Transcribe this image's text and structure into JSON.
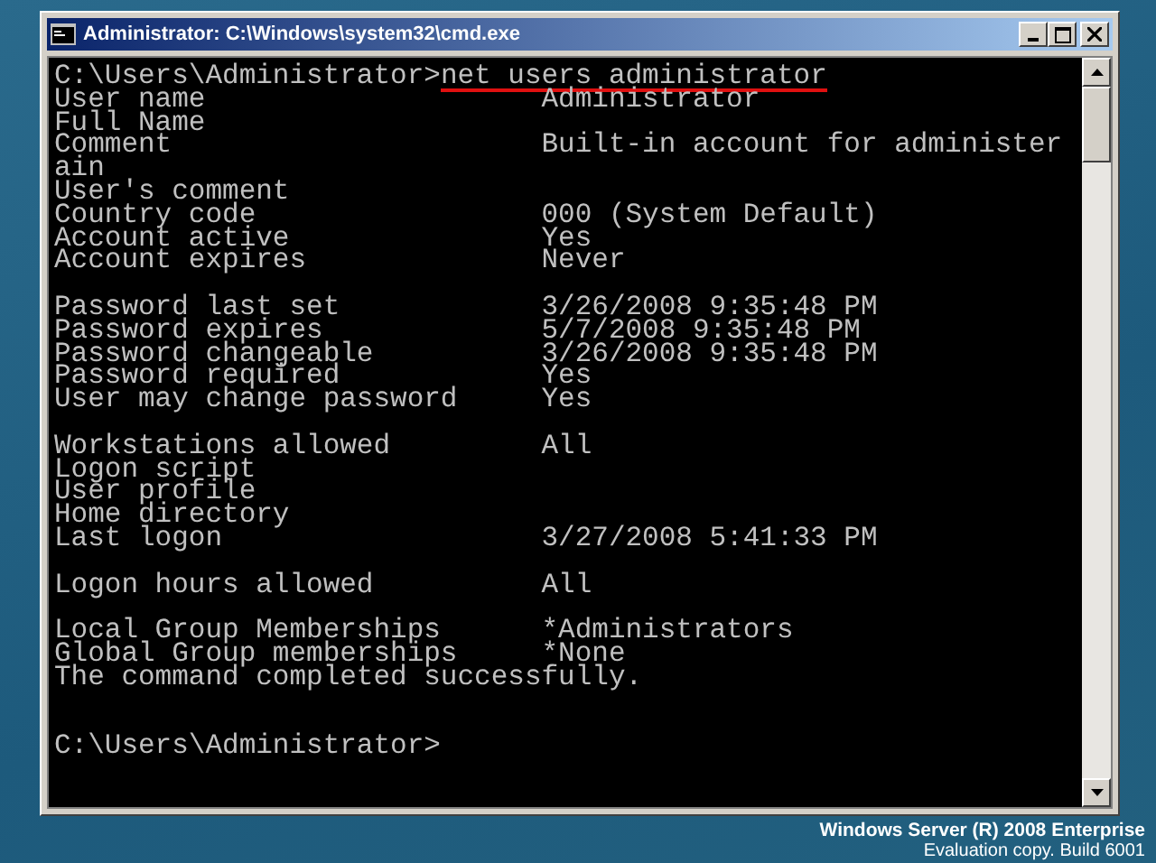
{
  "window": {
    "title": "Administrator: C:\\Windows\\system32\\cmd.exe"
  },
  "console": {
    "command_line": {
      "prompt": "C:\\Users\\Administrator>",
      "command": "net users administrator",
      "underlined": true
    },
    "sections": [
      [
        {
          "label": "User name",
          "value": "Administrator"
        },
        {
          "label": "Full Name"
        },
        {
          "label": "Comment",
          "value": "Built-in account for administer"
        },
        {
          "label": "ain"
        },
        {
          "label": "User's comment"
        },
        {
          "label": "Country code",
          "value": "000 (System Default)"
        },
        {
          "label": "Account active",
          "value": "Yes"
        },
        {
          "label": "Account expires",
          "value": "Never"
        }
      ],
      [
        {
          "label": "Password last set",
          "value": "3/26/2008 9:35:48 PM"
        },
        {
          "label": "Password expires",
          "value": "5/7/2008 9:35:48 PM"
        },
        {
          "label": "Password changeable",
          "value": "3/26/2008 9:35:48 PM"
        },
        {
          "label": "Password required",
          "value": "Yes"
        },
        {
          "label": "User may change password",
          "value": "Yes"
        }
      ],
      [
        {
          "label": "Workstations allowed",
          "value": "All"
        },
        {
          "label": "Logon script"
        },
        {
          "label": "User profile"
        },
        {
          "label": "Home directory"
        },
        {
          "label": "Last logon",
          "value": "3/27/2008 5:41:33 PM"
        }
      ],
      [
        {
          "label": "Logon hours allowed",
          "value": "All"
        }
      ],
      [
        {
          "label": "Local Group Memberships",
          "value": "*Administrators"
        },
        {
          "label": "Global Group memberships",
          "value": "*None"
        },
        {
          "label": "The command completed successfully."
        }
      ]
    ],
    "final_prompt": "C:\\Users\\Administrator>"
  },
  "branding": {
    "product": "Windows Server (R) 2008 Enterprise",
    "edition": "Evaluation copy. Build 6001"
  }
}
